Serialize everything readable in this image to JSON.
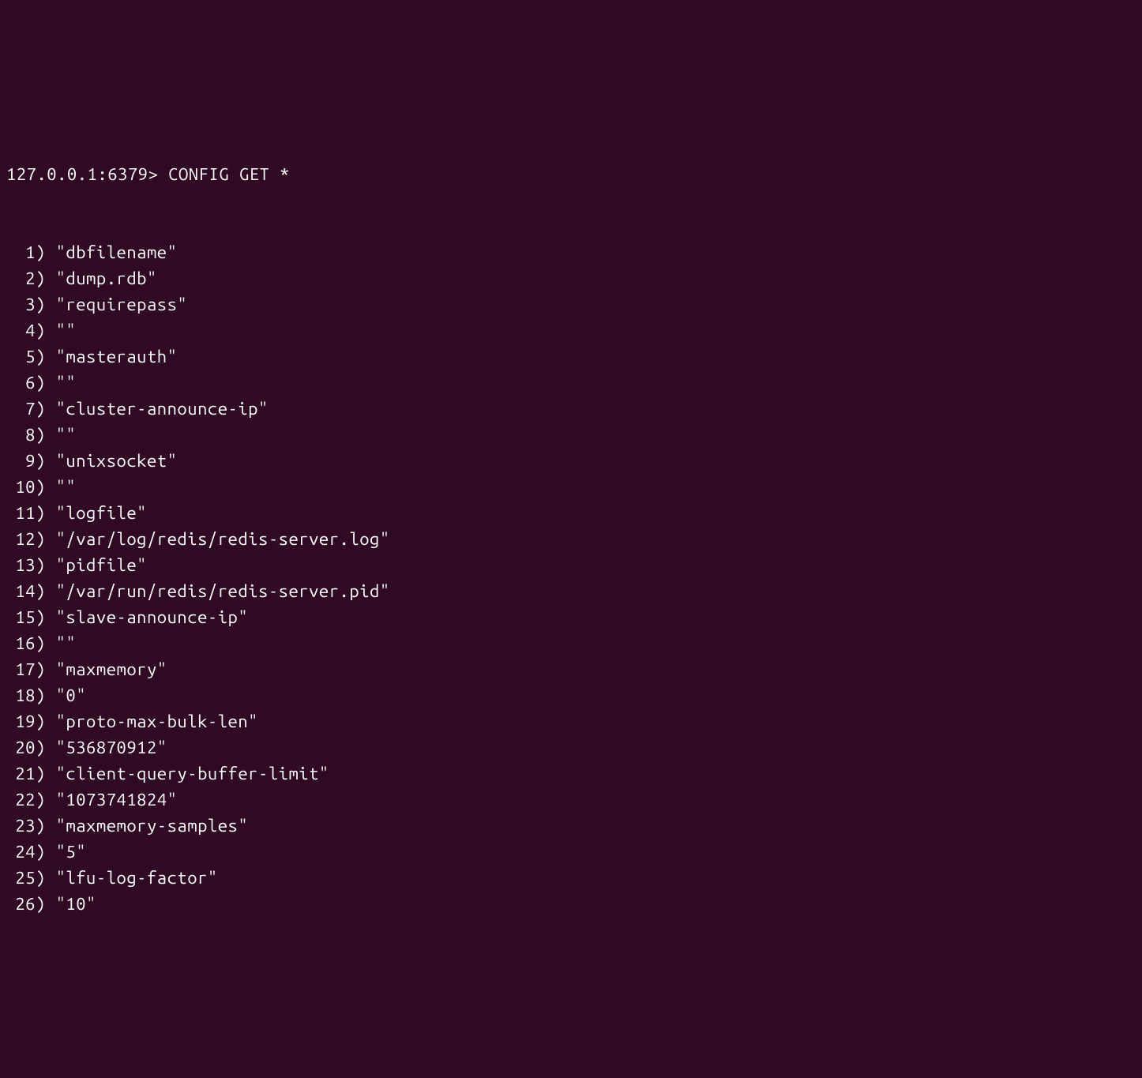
{
  "prompt": "127.0.0.1:6379>",
  "command": "CONFIG GET *",
  "output": [
    {
      "num": "1",
      "value": "\"dbfilename\""
    },
    {
      "num": "2",
      "value": "\"dump.rdb\""
    },
    {
      "num": "3",
      "value": "\"requirepass\""
    },
    {
      "num": "4",
      "value": "\"\""
    },
    {
      "num": "5",
      "value": "\"masterauth\""
    },
    {
      "num": "6",
      "value": "\"\""
    },
    {
      "num": "7",
      "value": "\"cluster-announce-ip\""
    },
    {
      "num": "8",
      "value": "\"\""
    },
    {
      "num": "9",
      "value": "\"unixsocket\""
    },
    {
      "num": "10",
      "value": "\"\""
    },
    {
      "num": "11",
      "value": "\"logfile\""
    },
    {
      "num": "12",
      "value": "\"/var/log/redis/redis-server.log\""
    },
    {
      "num": "13",
      "value": "\"pidfile\""
    },
    {
      "num": "14",
      "value": "\"/var/run/redis/redis-server.pid\""
    },
    {
      "num": "15",
      "value": "\"slave-announce-ip\""
    },
    {
      "num": "16",
      "value": "\"\""
    },
    {
      "num": "17",
      "value": "\"maxmemory\""
    },
    {
      "num": "18",
      "value": "\"0\""
    },
    {
      "num": "19",
      "value": "\"proto-max-bulk-len\""
    },
    {
      "num": "20",
      "value": "\"536870912\""
    },
    {
      "num": "21",
      "value": "\"client-query-buffer-limit\""
    },
    {
      "num": "22",
      "value": "\"1073741824\""
    },
    {
      "num": "23",
      "value": "\"maxmemory-samples\""
    },
    {
      "num": "24",
      "value": "\"5\""
    },
    {
      "num": "25",
      "value": "\"lfu-log-factor\""
    },
    {
      "num": "26",
      "value": "\"10\""
    }
  ]
}
